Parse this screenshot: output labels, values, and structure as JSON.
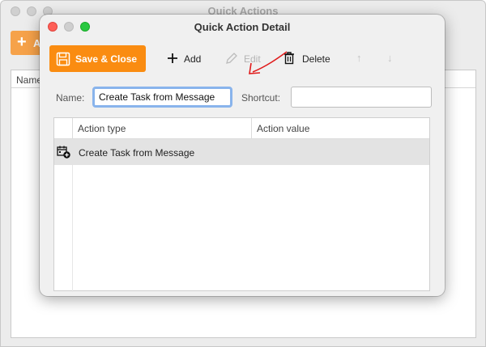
{
  "background_window": {
    "title": "Quick Actions",
    "add_label": "A",
    "table_header": "Name"
  },
  "dialog": {
    "title": "Quick Action Detail",
    "toolbar": {
      "save_close": "Save & Close",
      "add": "Add",
      "edit": "Edit",
      "delete": "Delete",
      "move_up": "↑",
      "move_down": "↓"
    },
    "form": {
      "name_label": "Name:",
      "name_value": "Create Task from Message",
      "shortcut_label": "Shortcut:",
      "shortcut_value": ""
    },
    "grid": {
      "columns": [
        "Action type",
        "Action value"
      ],
      "rows": [
        {
          "action_type": "Create Task from Message",
          "action_value": "",
          "icon": "calendar-add-icon"
        }
      ]
    }
  },
  "colors": {
    "accent_orange": "#fa8c11",
    "annotation_red": "#e01b1b",
    "focus_ring": "#89b4ec"
  }
}
